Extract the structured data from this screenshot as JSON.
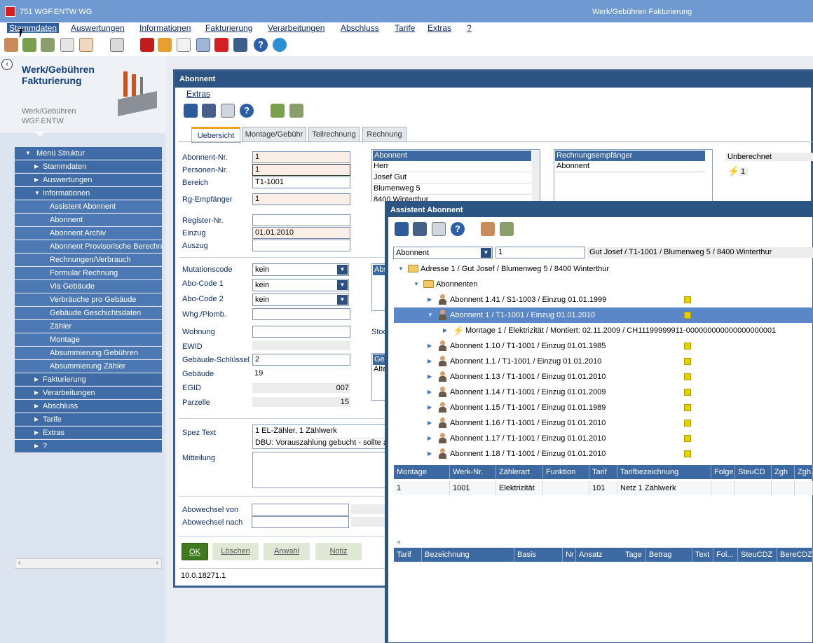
{
  "app": {
    "id": "751",
    "code": "WGF.ENTW",
    "module": "WG",
    "window_title": "Werk/Gebühren Fakturierung"
  },
  "menu": [
    "Stammdaten",
    "Auswertungen",
    "Informationen",
    "Fakturierung",
    "Verarbeitungen",
    "Abschluss",
    "Tarife",
    "Extras",
    "?"
  ],
  "left": {
    "title1": "Werk/Gebühren",
    "title2": "Fakturierung",
    "sub1": "Werk/Gebühren",
    "sub2": "WGF.ENTW",
    "tree": [
      {
        "label": "Menü Struktur",
        "level": 0,
        "open": true
      },
      {
        "label": "Stammdaten",
        "level": 1
      },
      {
        "label": "Auswertungen",
        "level": 1
      },
      {
        "label": "Informationen",
        "level": 1,
        "open": true
      },
      {
        "label": "Assistent Abonnent",
        "level": 2
      },
      {
        "label": "Abonnent",
        "level": 2
      },
      {
        "label": "Abonnent Archiv",
        "level": 2
      },
      {
        "label": "Abonnent Provisorische Berechn",
        "level": 2
      },
      {
        "label": "Rechnungen/Verbrauch",
        "level": 2
      },
      {
        "label": "Formular Rechnung",
        "level": 2
      },
      {
        "label": "Via Gebäude",
        "level": 2
      },
      {
        "label": "Verbräuche pro Gebäude",
        "level": 2
      },
      {
        "label": "Gebäude Geschichtsdaten",
        "level": 2
      },
      {
        "label": "Zähler",
        "level": 2
      },
      {
        "label": "Montage",
        "level": 2
      },
      {
        "label": "Absummierung Gebühren",
        "level": 2
      },
      {
        "label": "Absummierung Zähler",
        "level": 2
      },
      {
        "label": "Fakturierung",
        "level": 1
      },
      {
        "label": "Verarbeitungen",
        "level": 1
      },
      {
        "label": "Abschluss",
        "level": 1
      },
      {
        "label": "Tarife",
        "level": 1
      },
      {
        "label": "Extras",
        "level": 1
      },
      {
        "label": "?",
        "level": 1
      }
    ]
  },
  "abonnent": {
    "title": "Abonnent",
    "extras": "Extras",
    "tabs": [
      "Uebersicht",
      "Montage/Gebühr",
      "Teilrechnung",
      "Rechnung"
    ],
    "labels": {
      "abonnent_nr": "Abonnent-Nr.",
      "personen_nr": "Personen-Nr.",
      "bereich": "Bereich",
      "rg": "Rg-Empfänger",
      "register": "Register-Nr.",
      "einzug": "Einzug",
      "auszug": "Auszug",
      "mutation": "Mutationscode",
      "abo1": "Abo-Code 1",
      "abo2": "Abo-Code 2",
      "whg": "Whg./Plomb.",
      "wohnung": "Wohnung",
      "ewid": "EWID",
      "geb_schl": "Gebäude-Schlüssel",
      "gebaeude": "Gebäude",
      "egid": "EGID",
      "parzelle": "Parzelle",
      "spez": "Spez Text",
      "mitteilung": "Mitteilung",
      "abo_von": "Abowechsel von",
      "abo_nach": "Abowechsel nach",
      "stoc": "Stoc"
    },
    "values": {
      "abonnent_nr": "1",
      "personen_nr": "1",
      "bereich": "T1-1001",
      "rg": "1",
      "einzug": "01.01.2010",
      "mutation": "kein",
      "abo1": "kein",
      "abo2": "kein",
      "geb_schl": "2",
      "gebaeude": "19",
      "egid": "007",
      "parzelle": "15",
      "spez1": "1 EL-Zähler, 1 Zählwerk",
      "spez2": "DBU: Vorauszahlung gebucht - sollte a"
    },
    "addr_list": {
      "header": "Abonnent",
      "rows": [
        "Herr",
        "Josef Gut",
        "Blumenweg 5",
        "8400 Winterthur"
      ]
    },
    "rg_list": {
      "header": "Rechnungsempfänger",
      "rows": [
        "Abonnent"
      ]
    },
    "unberechnet": {
      "label": "Unberechnet",
      "value": "1"
    },
    "small1": "Abs",
    "small2a": "Geb",
    "small2b": "Alte",
    "buttons": {
      "ok": "OK",
      "loeschen": "Löschen",
      "anwahl": "Anwahl",
      "notiz": "Notiz"
    },
    "version": "10.0.18271.1"
  },
  "assistent": {
    "title": "Assistent Abonnent",
    "select": "Abonnent",
    "input": "1",
    "info": "Gut Josef / T1-1001 / Blumenweg 5 / 8400 Winterthur",
    "tree": [
      {
        "label": "Adresse 1 / Gut Josef / Blumenweg 5 / 8400 Winterthur",
        "type": "folder",
        "indent": 0,
        "open": true
      },
      {
        "label": "Abonnenten",
        "type": "folder",
        "indent": 1,
        "open": true
      },
      {
        "label": "Abonnent 1.41 / S1-1003 / Einzug 01.01.1999",
        "type": "person",
        "indent": 2,
        "flag": true
      },
      {
        "label": "Abonnent 1 / T1-1001 / Einzug 01.01.2010",
        "type": "person",
        "indent": 2,
        "flag": true,
        "selected": true,
        "open": true
      },
      {
        "label": "Montage 1 / Elektrizität / Montiert: 02.11.2009 / CH11199999911-000000000000000000001",
        "type": "bolt",
        "indent": 3
      },
      {
        "label": "Abonnent 1.10 / T1-1001 / Einzug 01.01.1985",
        "type": "person",
        "indent": 2,
        "flag": true
      },
      {
        "label": "Abonnent 1.1 / T1-1001 / Einzug 01.01.2010",
        "type": "person",
        "indent": 2,
        "flag": true
      },
      {
        "label": "Abonnent 1.13 / T1-1001 / Einzug 01.01.2010",
        "type": "person",
        "indent": 2,
        "flag": true
      },
      {
        "label": "Abonnent 1.14 / T1-1001 / Einzug 01.01.2009",
        "type": "person",
        "indent": 2,
        "flag": true
      },
      {
        "label": "Abonnent 1.15 / T1-1001 / Einzug 01.01.1989",
        "type": "person",
        "indent": 2,
        "flag": true
      },
      {
        "label": "Abonnent 1.16 / T1-1001 / Einzug 01.01.2010",
        "type": "person",
        "indent": 2,
        "flag": true
      },
      {
        "label": "Abonnent 1.17 / T1-1001 / Einzug 01.01.2010",
        "type": "person",
        "indent": 2,
        "flag": true
      },
      {
        "label": "Abonnent 1.18 / T1-1001 / Einzug 01.01.2010",
        "type": "person",
        "indent": 2,
        "flag": true
      }
    ],
    "table1": {
      "cols": [
        "Montage",
        "Werk-Nr.",
        "Zählerart",
        "Funktion",
        "Tarif",
        "Tarifbezeichnung",
        "Folge",
        "SteuCD",
        "Zgh",
        "Zgh."
      ],
      "rows": [
        [
          "1",
          "1001",
          "Elektrizität",
          "",
          "101",
          "Netz 1 Zählwerk",
          "",
          "",
          "",
          ""
        ]
      ]
    },
    "table2": {
      "cols": [
        "Tarif",
        "Bezeichnung",
        "Basis",
        "Nr",
        "Ansatz",
        "Tage",
        "Betrag",
        "Text",
        "Fol...",
        "SteuCDZ",
        "BereCDZ"
      ]
    }
  }
}
